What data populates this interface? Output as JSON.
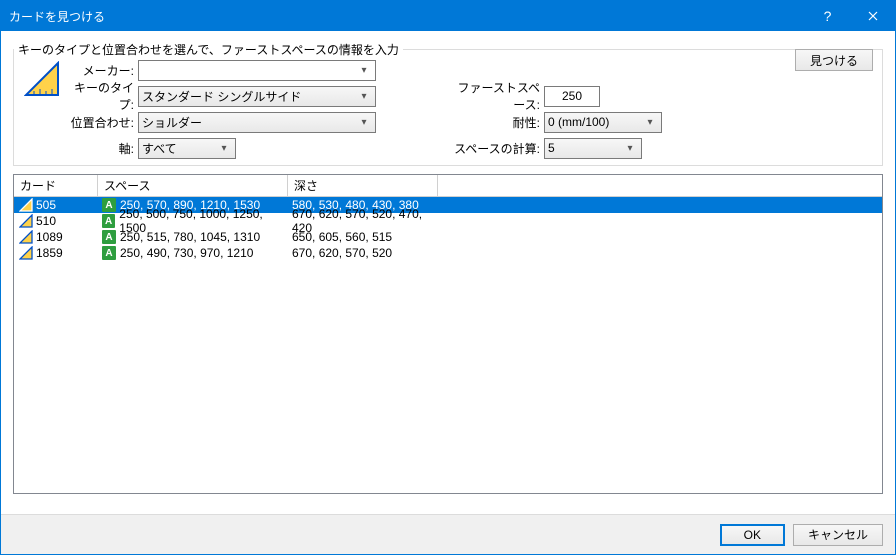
{
  "window": {
    "title": "カードを見つける"
  },
  "group_title": "キーのタイプと位置合わせを選んで、ファーストスペースの情報を入力",
  "labels": {
    "maker": "メーカー:",
    "key_type": "キーのタイプ:",
    "alignment": "位置合わせ:",
    "axis": "軸:",
    "first_space": "ファーストスペース:",
    "tolerance": "耐性:",
    "space_calc": "スペースの計算:"
  },
  "values": {
    "maker": "",
    "key_type": "スタンダード シングルサイド",
    "alignment": "ショルダー",
    "axis": "すべて",
    "first_space": "250",
    "tolerance": "0  (mm/100)",
    "space_calc": "5"
  },
  "buttons": {
    "find": "見つける",
    "ok": "OK",
    "cancel": "キャンセル"
  },
  "columns": {
    "card": "カード",
    "space": "スペース",
    "depth": "深さ"
  },
  "rows": [
    {
      "card": "505",
      "badge": "A",
      "space": "250, 570, 890, 1210, 1530",
      "depth": "580, 530, 480, 430, 380",
      "selected": true
    },
    {
      "card": "510",
      "badge": "A",
      "space": "250, 500, 750, 1000, 1250, 1500",
      "depth": "670, 620, 570, 520, 470, 420",
      "selected": false
    },
    {
      "card": "1089",
      "badge": "A",
      "space": "250, 515, 780, 1045, 1310",
      "depth": "650, 605, 560, 515",
      "selected": false
    },
    {
      "card": "1859",
      "badge": "A",
      "space": "250, 490, 730, 970, 1210",
      "depth": "670, 620, 570, 520",
      "selected": false
    }
  ]
}
